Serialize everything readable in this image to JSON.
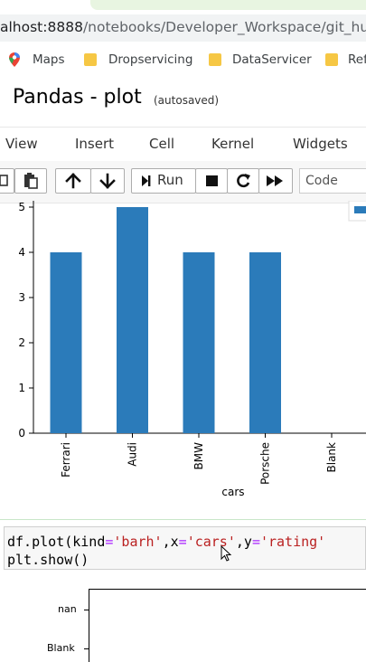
{
  "browser": {
    "url_prefix": "alhost:8888",
    "url_path": "/notebooks/Developer_Workspace/git_hub/",
    "bookmarks": [
      {
        "label": "Maps",
        "icon": "maps-pin-icon"
      },
      {
        "label": "Dropservicing",
        "icon": "folder-icon"
      },
      {
        "label": "DataServicer",
        "icon": "folder-icon"
      },
      {
        "label": "Ref",
        "icon": "folder-icon"
      }
    ]
  },
  "notebook": {
    "title": "Pandas - plot",
    "status": "(autosaved)"
  },
  "menu": {
    "items": [
      "View",
      "Insert",
      "Cell",
      "Kernel",
      "Widgets"
    ]
  },
  "toolbar": {
    "run_label": "Run",
    "cell_type": "Code"
  },
  "chart_data": {
    "type": "bar",
    "categories": [
      "Ferrari",
      "Audi",
      "BMW",
      "Porsche",
      "Blank"
    ],
    "values": [
      4,
      5,
      4,
      4,
      0
    ],
    "xlabel": "cars",
    "ylabel": "",
    "ylim": [
      0,
      5
    ],
    "yticks": [
      0,
      1,
      2,
      3,
      4,
      5
    ],
    "bar_color": "#2b7bba",
    "legend": "top-right"
  },
  "code": {
    "line1_parts": [
      "df.plot(kind",
      "=",
      "'barh'",
      ",x",
      "=",
      "'cars'",
      ",y",
      "=",
      "'rating'"
    ],
    "line2": "plt.show()"
  },
  "plot2": {
    "ytick_labels": [
      "nan",
      "Blank"
    ]
  }
}
